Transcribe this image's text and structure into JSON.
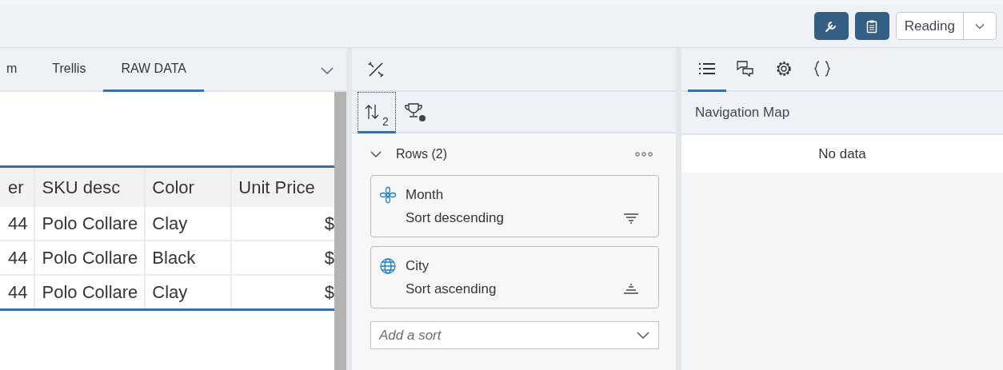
{
  "toolbar": {
    "buttons": [
      {
        "kind": "wrench"
      },
      {
        "kind": "clipboard"
      }
    ],
    "mode": {
      "value": "Reading"
    }
  },
  "left_tabs": [
    {
      "label": "m",
      "selected": false
    },
    {
      "label": "Trellis",
      "selected": false
    },
    {
      "label": "RAW DATA",
      "selected": true
    }
  ],
  "table": {
    "columns": [
      "er",
      "SKU desc",
      "Color",
      "Unit Price"
    ],
    "rows": [
      [
        "44",
        "Polo Collare",
        "Clay",
        "$"
      ],
      [
        "44",
        "Polo Collare",
        "Black",
        "$"
      ],
      [
        "44",
        "Polo Collare",
        "Clay",
        "$"
      ]
    ]
  },
  "builder_tabs": [
    {
      "kind": "sort",
      "subscript": "2",
      "selected": true
    },
    {
      "kind": "trophy",
      "selected": false
    }
  ],
  "rows_section": {
    "title": "Rows (2)",
    "expanded": true,
    "sorts": [
      {
        "field": {
          "kind": "hierarchy",
          "name": "Month"
        },
        "kind": "descending",
        "label": "Sort descending"
      },
      {
        "field": {
          "kind": "geo",
          "name": "City"
        },
        "kind": "ascending",
        "label": "Sort ascending"
      }
    ],
    "add_sort": {
      "placeholder": "Add a sort"
    }
  },
  "right_tabs": [
    {
      "kind": "list",
      "selected": true
    },
    {
      "kind": "comments",
      "selected": false
    },
    {
      "kind": "gear",
      "selected": false
    },
    {
      "kind": "braces",
      "selected": false
    }
  ],
  "navigation_map": {
    "title": "Navigation Map",
    "empty_text": "No data"
  }
}
